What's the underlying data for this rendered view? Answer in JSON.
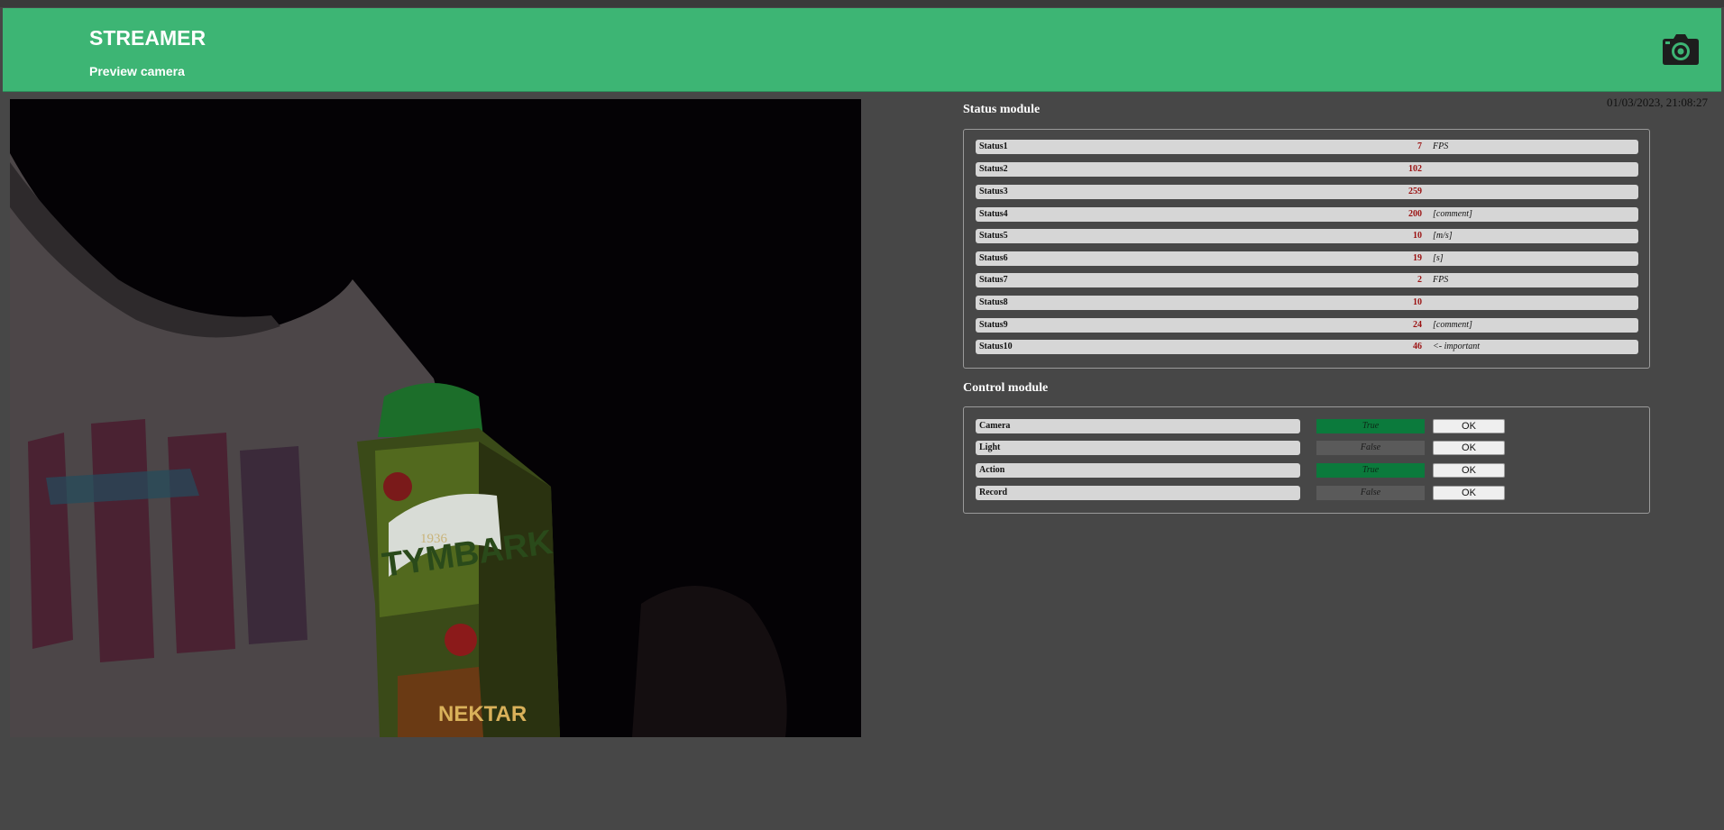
{
  "header": {
    "title": "STREAMER",
    "subtitle": "Preview camera",
    "icon": "camera-icon",
    "background": "#3db574"
  },
  "preview": {
    "product_text": "TYMBARK",
    "secondary_text": "NEKTAR",
    "year_text": "1936"
  },
  "datetime": "01/03/2023, 21:08:27",
  "status_module": {
    "title": "Status module",
    "rows": [
      {
        "name": "Status1",
        "value": "7",
        "unit": "FPS"
      },
      {
        "name": "Status2",
        "value": "102",
        "unit": ""
      },
      {
        "name": "Status3",
        "value": "259",
        "unit": ""
      },
      {
        "name": "Status4",
        "value": "200",
        "unit": "[comment]"
      },
      {
        "name": "Status5",
        "value": "10",
        "unit": "[m/s]"
      },
      {
        "name": "Status6",
        "value": "19",
        "unit": "[s]"
      },
      {
        "name": "Status7",
        "value": "2",
        "unit": "FPS"
      },
      {
        "name": "Status8",
        "value": "10",
        "unit": ""
      },
      {
        "name": "Status9",
        "value": "24",
        "unit": "[comment]"
      },
      {
        "name": "Status10",
        "value": "46",
        "unit": "<- important"
      }
    ]
  },
  "control_module": {
    "title": "Control module",
    "rows": [
      {
        "name": "Camera",
        "state": "True",
        "button": "OK"
      },
      {
        "name": "Light",
        "state": "False",
        "button": "OK"
      },
      {
        "name": "Action",
        "state": "True",
        "button": "OK"
      },
      {
        "name": "Record",
        "state": "False",
        "button": "OK"
      }
    ]
  }
}
